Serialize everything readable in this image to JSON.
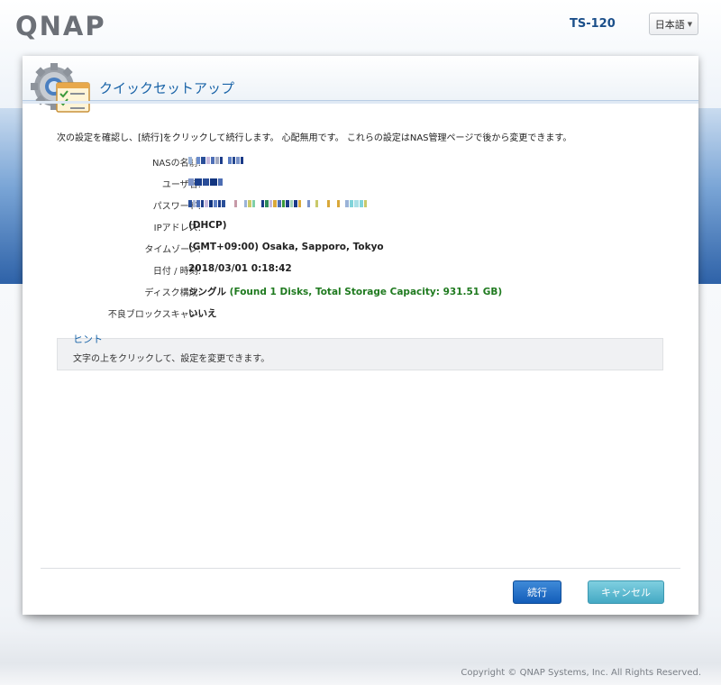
{
  "header": {
    "logo": "QNAP",
    "model": "TS-120",
    "language": "日本語"
  },
  "panel": {
    "title": "クイックセットアップ",
    "intro": "次の設定を確認し、[続行]をクリックして続行します。 心配無用です。 これらの設定はNAS管理ページで後から変更できます。",
    "fields": [
      {
        "label": "NASの名前:",
        "value": ""
      },
      {
        "label": "ユーザ名:",
        "value": ""
      },
      {
        "label": "パスワード:",
        "value": ""
      },
      {
        "label": "IPアドレス:",
        "value": "(DHCP)"
      },
      {
        "label": "タイムゾーン:",
        "value": "(GMT+09:00) Osaka, Sapporo, Tokyo"
      },
      {
        "label": "日付 / 時刻:",
        "value": "2018/03/01 0:18:42"
      },
      {
        "label": "ディスク構成:",
        "value": "シングル",
        "value_extra": "(Found 1 Disks, Total Storage Capacity: 931.51 GB)"
      },
      {
        "label": "不良ブロックスキャン:",
        "value": "いいえ"
      }
    ],
    "hint": {
      "title": "ヒント",
      "text": "文字の上をクリックして、設定を変更できます。"
    },
    "buttons": {
      "run": "続行",
      "cancel": "キャンセル"
    }
  },
  "footer": {
    "copyright": "Copyright © QNAP Systems, Inc. All Rights Reserved."
  },
  "colors": {
    "accent": "#1a64a8",
    "run_button": "#135db9",
    "cancel_button": "#44a9c4",
    "capacity_text": "#1f7a1f"
  },
  "icons": {
    "panel_icon": "gear-checklist-icon",
    "language_caret": "caret-down-icon"
  }
}
